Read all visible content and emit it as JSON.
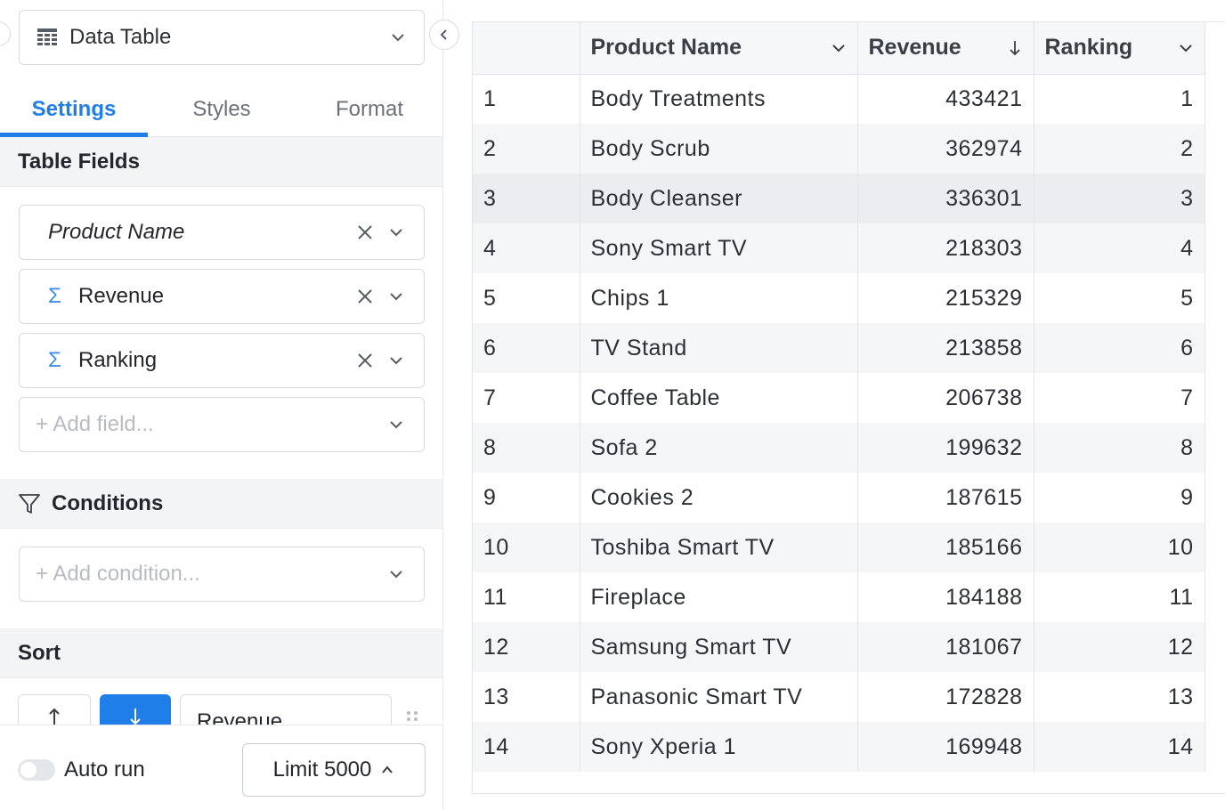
{
  "sidebar": {
    "viz_type": "Data Table",
    "tabs": [
      {
        "label": "Settings",
        "active": true
      },
      {
        "label": "Styles",
        "active": false
      },
      {
        "label": "Format",
        "active": false
      }
    ],
    "table_fields": {
      "title": "Table Fields",
      "fields": [
        {
          "name": "Product Name",
          "type": "dimension"
        },
        {
          "name": "Revenue",
          "type": "measure",
          "icon": "Σ"
        },
        {
          "name": "Ranking",
          "type": "measure",
          "icon": "Σ"
        }
      ],
      "add_placeholder": "+ Add field..."
    },
    "conditions": {
      "title": "Conditions",
      "add_placeholder": "+ Add condition..."
    },
    "sort": {
      "title": "Sort",
      "field": "Revenue",
      "direction": "descending"
    },
    "footer": {
      "autorun_label": "Auto run",
      "autorun_on": false,
      "limit_label": "Limit 5000"
    }
  },
  "colors": {
    "accent": "#1f7ee8",
    "header_bg": "#f6f7f9",
    "stripe_bg": "#f5f6f8",
    "border": "#e1e4e8"
  },
  "table": {
    "columns": [
      {
        "label": "",
        "key": "idx"
      },
      {
        "label": "Product Name",
        "key": "product",
        "icon": "chevron-down-icon"
      },
      {
        "label": "Revenue",
        "key": "revenue",
        "icon": "arrow-down-icon"
      },
      {
        "label": "Ranking",
        "key": "ranking",
        "icon": "chevron-down-icon"
      }
    ],
    "rows": [
      {
        "idx": "1",
        "product": "Body Treatments",
        "revenue": "433421",
        "ranking": "1"
      },
      {
        "idx": "2",
        "product": "Body Scrub",
        "revenue": "362974",
        "ranking": "2"
      },
      {
        "idx": "3",
        "product": "Body Cleanser",
        "revenue": "336301",
        "ranking": "3"
      },
      {
        "idx": "4",
        "product": "Sony Smart TV",
        "revenue": "218303",
        "ranking": "4"
      },
      {
        "idx": "5",
        "product": "Chips 1",
        "revenue": "215329",
        "ranking": "5"
      },
      {
        "idx": "6",
        "product": "TV Stand",
        "revenue": "213858",
        "ranking": "6"
      },
      {
        "idx": "7",
        "product": "Coffee Table",
        "revenue": "206738",
        "ranking": "7"
      },
      {
        "idx": "8",
        "product": "Sofa 2",
        "revenue": "199632",
        "ranking": "8"
      },
      {
        "idx": "9",
        "product": "Cookies 2",
        "revenue": "187615",
        "ranking": "9"
      },
      {
        "idx": "10",
        "product": "Toshiba Smart TV",
        "revenue": "185166",
        "ranking": "10"
      },
      {
        "idx": "11",
        "product": "Fireplace",
        "revenue": "184188",
        "ranking": "11"
      },
      {
        "idx": "12",
        "product": "Samsung Smart TV",
        "revenue": "181067",
        "ranking": "12"
      },
      {
        "idx": "13",
        "product": "Panasonic Smart TV",
        "revenue": "172828",
        "ranking": "13"
      },
      {
        "idx": "14",
        "product": "Sony Xperia 1",
        "revenue": "169948",
        "ranking": "14"
      }
    ]
  }
}
